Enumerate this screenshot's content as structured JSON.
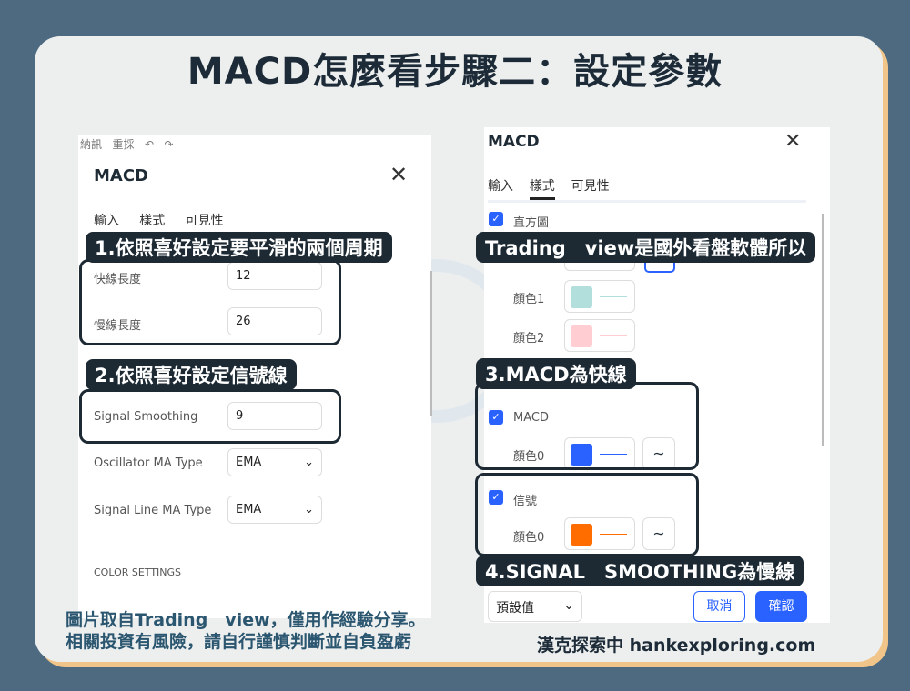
{
  "title": "MACD怎麼看步驟二：設定參數",
  "left": {
    "toolbar": [
      "納訊",
      "重採",
      "↶",
      "↷"
    ],
    "dialog_title": "MACD",
    "tabs": [
      "輸入",
      "樣式",
      "可見性"
    ],
    "fields": [
      {
        "label": "快線長度",
        "value": "12"
      },
      {
        "label": "慢線長度",
        "value": "26"
      },
      {
        "label": "Signal Smoothing",
        "value": "9"
      },
      {
        "label": "Oscillator MA Type",
        "value": "EMA"
      },
      {
        "label": "Signal Line MA Type",
        "value": "EMA"
      }
    ],
    "section": "COLOR SETTINGS"
  },
  "right": {
    "dialog_title": "MACD",
    "tabs": [
      "輸入",
      "樣式",
      "可見性"
    ],
    "active_tab": "樣式",
    "histogram": "直方圖",
    "color1": "顏色1",
    "color2": "顏色2",
    "macd": "MACD",
    "macd_color": "顏色0",
    "signal": "信號",
    "signal_color": "顏色0",
    "preset": "預設值",
    "cancel": "取消",
    "confirm": "確認",
    "colors": {
      "hist0": "#26a69a",
      "hist1": "#b2dfdb",
      "hist2": "#ffcdd2",
      "macd": "#2962ff",
      "signal": "#ff6d00"
    }
  },
  "callouts": [
    "1.依照喜好設定要平滑的兩個周期",
    "2.依照喜好設定信號線",
    "Trading　view是國外看盤軟體所以",
    "3.MACD為快線",
    "4.SIGNAL　SMOOTHING為慢線"
  ],
  "footer": {
    "line1": "圖片取自Trading　view，僅用作經驗分享。",
    "line2": "相關投資有風險，請自行謹慎判斷並自負盈虧",
    "brand": "漢克探索中 hankexploring.com"
  }
}
